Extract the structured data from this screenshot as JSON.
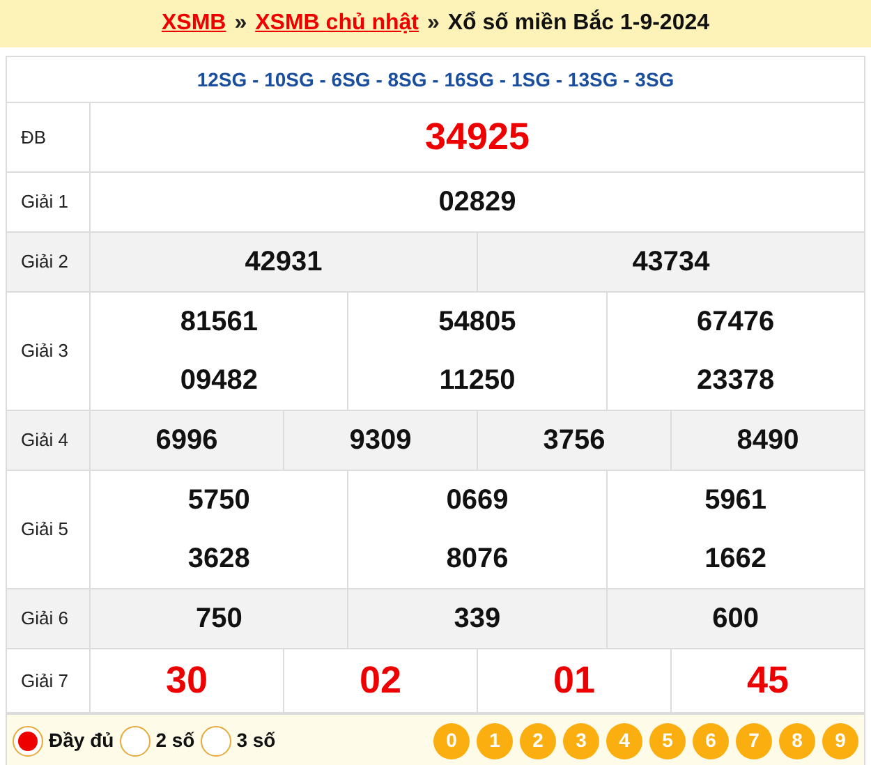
{
  "breadcrumb": {
    "links": [
      "XSMB",
      "XSMB chủ nhật"
    ],
    "separator": "»",
    "title": "Xổ số miền Bắc 1-9-2024"
  },
  "codes": "12SG - 10SG - 6SG - 8SG - 16SG - 1SG - 13SG - 3SG",
  "prizes": [
    {
      "label": "ĐB",
      "kind": "special",
      "shaded": false,
      "rows": [
        [
          "34925"
        ]
      ]
    },
    {
      "label": "Giải 1",
      "kind": "normal",
      "shaded": false,
      "rows": [
        [
          "02829"
        ]
      ]
    },
    {
      "label": "Giải 2",
      "kind": "normal",
      "shaded": true,
      "rows": [
        [
          "42931",
          "43734"
        ]
      ]
    },
    {
      "label": "Giải 3",
      "kind": "normal",
      "shaded": false,
      "rows": [
        [
          "81561",
          "54805",
          "67476"
        ],
        [
          "09482",
          "11250",
          "23378"
        ]
      ]
    },
    {
      "label": "Giải 4",
      "kind": "normal",
      "shaded": true,
      "rows": [
        [
          "6996",
          "9309",
          "3756",
          "8490"
        ]
      ]
    },
    {
      "label": "Giải 5",
      "kind": "normal",
      "shaded": false,
      "rows": [
        [
          "5750",
          "0669",
          "5961"
        ],
        [
          "3628",
          "8076",
          "1662"
        ]
      ]
    },
    {
      "label": "Giải 6",
      "kind": "normal",
      "shaded": true,
      "rows": [
        [
          "750",
          "339",
          "600"
        ]
      ]
    },
    {
      "label": "Giải 7",
      "kind": "last",
      "shaded": false,
      "rows": [
        [
          "30",
          "02",
          "01",
          "45"
        ]
      ]
    }
  ],
  "display_options": [
    {
      "label": "Đầy đủ",
      "selected": true
    },
    {
      "label": "2 số",
      "selected": false
    },
    {
      "label": "3 số",
      "selected": false
    }
  ],
  "digits": [
    "0",
    "1",
    "2",
    "3",
    "4",
    "5",
    "6",
    "7",
    "8",
    "9"
  ]
}
